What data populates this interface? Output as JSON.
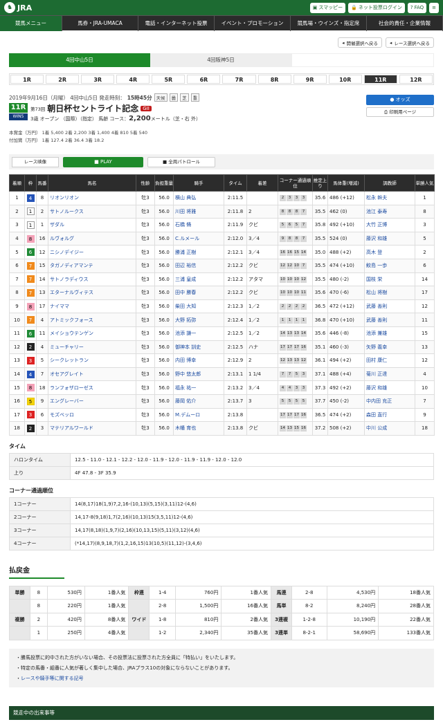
{
  "header": {
    "logo": "JRA",
    "buttons": [
      "スマッピー",
      "ネット投票ログイン",
      "FAQ",
      "メニュー"
    ]
  },
  "nav": [
    "競馬メニュー",
    "馬券・JRA-UMACA",
    "電話・インターネット投票",
    "イベント・プロモーション",
    "競馬場・ウインズ・指定席",
    "社会的責任・企業情報"
  ],
  "top_buttons": [
    "開催選択へ戻る",
    "レース選択へ戻る"
  ],
  "venues": [
    "4回中山5日",
    "4回阪神5日",
    ""
  ],
  "races": [
    "1R",
    "2R",
    "3R",
    "4R",
    "5R",
    "6R",
    "7R",
    "8R",
    "9R",
    "10R",
    "11R",
    "12R"
  ],
  "race": {
    "date": "2019年9月16日（月曜） 4回中山5日 発走時刻：",
    "time": "15時45分",
    "badges": [
      "天候",
      "曇",
      "芝",
      "重"
    ],
    "num": "11R",
    "win5": "WIN5",
    "title_pre": "第73回",
    "title": "朝日杯セントライト記念",
    "grade": "GII",
    "cond_pre": "3歳 オープン （国際）（指定） 馬齢 コース：",
    "dist": "2,200",
    "cond_post": "メートル（芝・右 外）",
    "prize1": "本賞金（万円） 1着 5,400 2着 2,200 3着 1,400 4着 810 5着 540",
    "prize2": "付加賞（万円） 1着 127.4 2着 36.4 3着 18.2",
    "odds_btn": "オッズ",
    "print_btn": "印刷用ページ"
  },
  "video": {
    "label": "レース映像",
    "play": "PLAY",
    "patrol": "全周パトロール"
  },
  "table": {
    "headers": [
      "着順",
      "枠",
      "馬番",
      "馬名",
      "性齢",
      "負担重量",
      "騎手",
      "タイム",
      "着差",
      "コーナー通過順位",
      "推定上り",
      "馬体重(増減)",
      "調教師",
      "単勝人気"
    ],
    "rows": [
      [
        "1",
        "4",
        "8",
        "リオンリオン",
        "牡3",
        "56.0",
        "横山 典弘",
        "2:11.5",
        "",
        "2 3 3 3",
        "35.6",
        "486 (+12)",
        "松永 幹夫",
        "1"
      ],
      [
        "2",
        "1",
        "2",
        "サトノルークス",
        "牡3",
        "56.0",
        "川田 将雅",
        "2:11.8",
        "2",
        "8 8 8 7",
        "35.5",
        "462 (0)",
        "池江 泰寿",
        "8"
      ],
      [
        "3",
        "1",
        "1",
        "ザダル",
        "牡3",
        "56.0",
        "石橋 脩",
        "2:11.9",
        "クビ",
        "5 6 5 7",
        "35.8",
        "492 (+10)",
        "大竹 正博",
        "3"
      ],
      [
        "4",
        "8",
        "16",
        "ルヴォルグ",
        "牡3",
        "56.0",
        "C.ルメール",
        "2:12.0",
        "3／4",
        "9 8 8 7",
        "35.5",
        "524 (0)",
        "藤沢 和雄",
        "5"
      ],
      [
        "5",
        "6",
        "12",
        "ニシノデイジー",
        "牡3",
        "56.0",
        "勝浦 正樹",
        "2:12.1",
        "3／4",
        "16 16 15 14",
        "35.0",
        "488 (+2)",
        "高木 登",
        "2"
      ],
      [
        "6",
        "7",
        "15",
        "タガノディアマンテ",
        "牡3",
        "56.0",
        "田辺 裕信",
        "2:12.2",
        "クビ",
        "12 12 10 7",
        "35.5",
        "474 (+10)",
        "鮫島 一歩",
        "6"
      ],
      [
        "7",
        "7",
        "14",
        "サトノラディウス",
        "牡3",
        "56.0",
        "三浦 皇成",
        "2:12.2",
        "アタマ",
        "10 10 10 12",
        "35.5",
        "480 (-2)",
        "国枝 栄",
        "14"
      ],
      [
        "8",
        "7",
        "13",
        "エターナルヴィテス",
        "牡3",
        "56.0",
        "田中 勝春",
        "2:12.2",
        "クビ",
        "10 10 10 11",
        "35.6",
        "470 (-6)",
        "松山 将樹",
        "17"
      ],
      [
        "9",
        "8",
        "17",
        "ナイママ",
        "牡3",
        "56.0",
        "柴田 大知",
        "2:12.3",
        "1／2",
        "2 2 2 2",
        "36.5",
        "472 (+12)",
        "武藤 善則",
        "12"
      ],
      [
        "10",
        "7",
        "4",
        "アトミックフォース",
        "牡3",
        "56.0",
        "大野 拓弥",
        "2:12.4",
        "1／2",
        "1 1 1 1",
        "36.8",
        "470 (+10)",
        "武藤 善則",
        "11"
      ],
      [
        "11",
        "6",
        "11",
        "メイショウテンゲン",
        "牡3",
        "56.0",
        "池添 謙一",
        "2:12.5",
        "1／2",
        "14 13 13 14",
        "35.6",
        "446 (-8)",
        "池添 兼雄",
        "15"
      ],
      [
        "12",
        "2",
        "4",
        "ミューチャリー",
        "牡3",
        "56.0",
        "御神本 訓史",
        "2:12.5",
        "ハナ",
        "17 17 17 16",
        "35.1",
        "460 (-3)",
        "矢野 義幸",
        "13"
      ],
      [
        "13",
        "3",
        "5",
        "シークレットラン",
        "牡3",
        "56.0",
        "内田 博幸",
        "2:12.9",
        "2",
        "12 13 13 12",
        "36.1",
        "494 (+2)",
        "田村 康仁",
        "12"
      ],
      [
        "14",
        "4",
        "7",
        "オセアグレイト",
        "牡3",
        "56.0",
        "野中 悠太郎",
        "2:13.1",
        "1 1/4",
        "7 7 5 3",
        "37.1",
        "488 (+4)",
        "菊川 正達",
        "4"
      ],
      [
        "15",
        "8",
        "18",
        "ランフォザローゼス",
        "牡3",
        "56.0",
        "福永 祐一",
        "2:13.2",
        "3／4",
        "4 4 3 3",
        "37.3",
        "492 (+2)",
        "藤沢 和雄",
        "10"
      ],
      [
        "16",
        "5",
        "9",
        "エングレーバー",
        "牡3",
        "56.0",
        "藤岡 佑介",
        "2:13.7",
        "3",
        "5 5 5 5",
        "37.7",
        "450 (-2)",
        "中内田 充正",
        "7"
      ],
      [
        "17",
        "3",
        "6",
        "モズベッロ",
        "牡3",
        "56.0",
        "M.デムーロ",
        "2:13.8",
        "",
        "17 17 17 16",
        "36.5",
        "474 (+2)",
        "森田 直行",
        "9"
      ],
      [
        "18",
        "2",
        "3",
        "マテリアルワールド",
        "牡3",
        "56.0",
        "木幡 育也",
        "2:13.8",
        "クビ",
        "14 13 15 16",
        "37.2",
        "508 (+2)",
        "中川 公成",
        "18"
      ]
    ]
  },
  "time_section": {
    "title": "タイム",
    "rows": [
      [
        "ハロンタイム",
        "12.5 - 11.0 - 12.1 - 12.2 - 12.0 - 11.9 - 12.0 - 11.9 - 11.9 - 12.0 - 12.0"
      ],
      [
        "上り",
        "4F 47.8 - 3F 35.9"
      ]
    ]
  },
  "corner_section": {
    "title": "コーナー通過順位",
    "rows": [
      [
        "1コーナー",
        "14(8,17)18(1,9)7,2,16-(10,13)(5,15)(3,11)12-(4,6)"
      ],
      [
        "2コーナー",
        "14,17-8(9,18)1,7(2,16)(10,13)15(3,5,11)12-(4,6)"
      ],
      [
        "3コーナー",
        "14,17(8,18)(1,9,7)(2,16)(10,13,15)(5,11)(3,12)(4,6)"
      ],
      [
        "4コーナー",
        "(*14,17)(8,9,18,7)(1,2,16,15)13(10,5)(11,12)-(3,4,6)"
      ]
    ]
  },
  "payout": {
    "title": "払戻金",
    "rows": [
      [
        "単勝",
        "8",
        "530円",
        "1番人気",
        "枠連",
        "1-4",
        "760円",
        "1番人気",
        "馬連",
        "2-8",
        "4,530円",
        "18番人気"
      ],
      [
        "",
        "8",
        "220円",
        "1番人気",
        "",
        "2-8",
        "1,500円",
        "16番人気",
        "馬単",
        "8-2",
        "8,240円",
        "28番人気"
      ],
      [
        "複勝",
        "2",
        "420円",
        "8番人気",
        "ワイド",
        "1-8",
        "810円",
        "2番人気",
        "3連複",
        "1-2-8",
        "10,190円",
        "22番人気"
      ],
      [
        "",
        "1",
        "250円",
        "4番人気",
        "",
        "1-2",
        "2,340円",
        "35番人気",
        "3連単",
        "8-2-1",
        "58,690円",
        "133番人気"
      ]
    ]
  },
  "notes": [
    "勝馬投票に的中された方がいない場合、その投票法に投票された方全員に「特払い」をいたします。",
    "特定の馬番・組番に人気が著しく集中した場合、JRAプラス10の対象にならないことがあります。",
    "レースや騎手等に関する記号"
  ],
  "footer": "競走中の出来事等"
}
